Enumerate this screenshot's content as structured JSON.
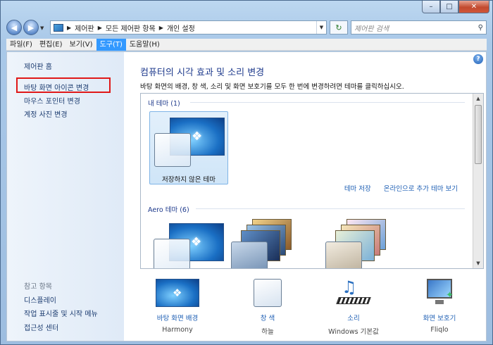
{
  "window": {
    "minimize": "–",
    "maximize": "□",
    "close": "✕"
  },
  "nav": {
    "back": "◀",
    "forward": "▶",
    "refresh": "↻"
  },
  "breadcrumb": [
    "제어판",
    "모든 제어판 항목",
    "개인 설정"
  ],
  "search": {
    "placeholder": "제어판 검색"
  },
  "menu": [
    {
      "label": "파일(F)"
    },
    {
      "label": "편집(E)"
    },
    {
      "label": "보기(V)"
    },
    {
      "label": "도구(T)",
      "active": true
    },
    {
      "label": "도움말(H)"
    }
  ],
  "sidebar": {
    "home": "제어판 홈",
    "links": [
      "바탕 화면 아이콘 변경",
      "마우스 포인터 변경",
      "계정 사진 변경"
    ],
    "see_also": "참고 항목",
    "related": [
      "디스플레이",
      "작업 표시줄 및 시작 메뉴",
      "접근성 센터"
    ],
    "highlight_color": "#e01818"
  },
  "main": {
    "help": "?",
    "title": "컴퓨터의 시각 효과 및 소리 변경",
    "description": "바탕 화면의 배경, 창 색, 소리 및 화면 보호기를 모두 한 번에 변경하려면 테마를 클릭하십시오.",
    "my_themes": {
      "header": "내 테마 (1)",
      "items": [
        {
          "name": "저장하지 않은 테마"
        }
      ]
    },
    "actions": {
      "save": "테마 저장",
      "online": "온라인으로 추가 테마 보기"
    },
    "aero_themes": {
      "header": "Aero 테마 (6)"
    }
  },
  "bottom": [
    {
      "label": "바탕 화면 배경",
      "sub": "Harmony",
      "icon": "desktop-background-icon"
    },
    {
      "label": "창 색",
      "sub": "하늘",
      "icon": "window-color-icon"
    },
    {
      "label": "소리",
      "sub": "Windows 기본값",
      "icon": "sound-icon"
    },
    {
      "label": "화면 보호기",
      "sub": "Fliqlo",
      "icon": "screensaver-icon"
    }
  ]
}
